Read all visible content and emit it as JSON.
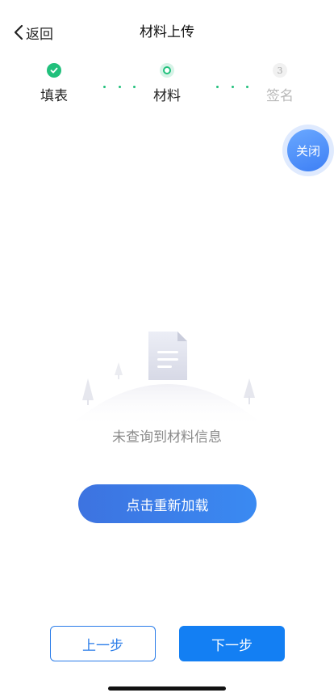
{
  "header": {
    "back_label": "返回",
    "title": "材料上传"
  },
  "steps": [
    {
      "label": "填表",
      "state": "done",
      "number": ""
    },
    {
      "label": "材料",
      "state": "current",
      "number": ""
    },
    {
      "label": "签名",
      "state": "todo",
      "number": "3"
    }
  ],
  "float_close": {
    "label": "关闭"
  },
  "empty": {
    "message": "未查询到材料信息",
    "reload_label": "点击重新加载"
  },
  "footer": {
    "prev_label": "上一步",
    "next_label": "下一步"
  },
  "colors": {
    "accent_green": "#21c07c",
    "accent_blue": "#137ff3"
  }
}
